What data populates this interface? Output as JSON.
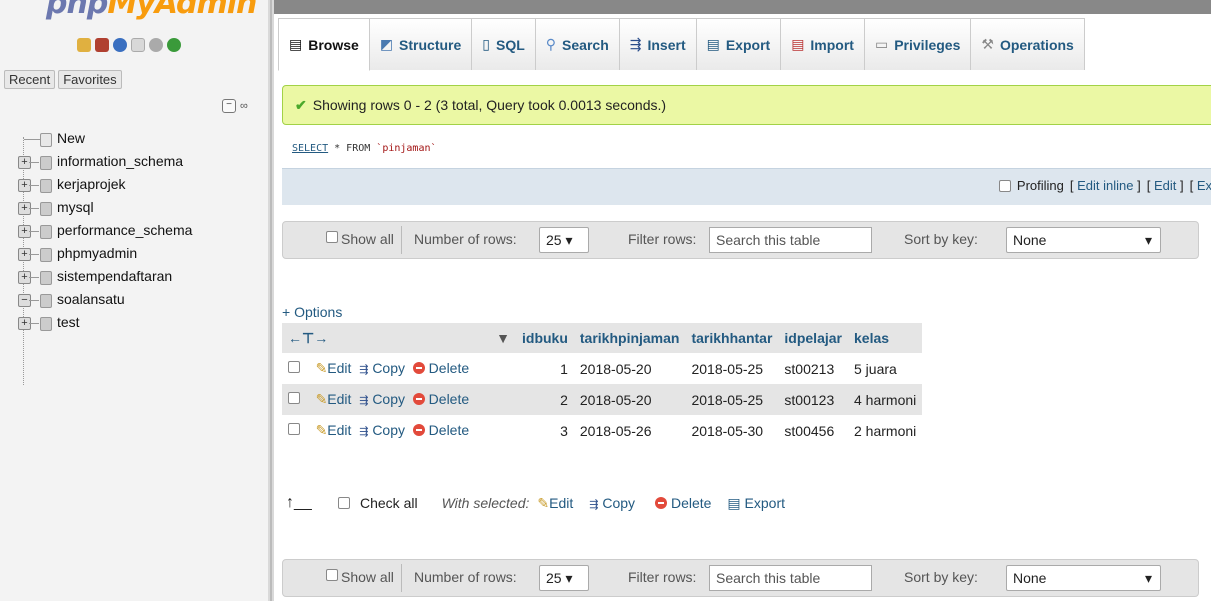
{
  "nav": {
    "logo_a": "php",
    "logo_b": "MyAdmin",
    "tabs": [
      "Recent",
      "Favorites"
    ],
    "tree": [
      {
        "label": "New",
        "type": "new"
      },
      {
        "label": "information_schema",
        "type": "db"
      },
      {
        "label": "kerjaprojek",
        "type": "db"
      },
      {
        "label": "mysql",
        "type": "db"
      },
      {
        "label": "performance_schema",
        "type": "db"
      },
      {
        "label": "phpmyadmin",
        "type": "db"
      },
      {
        "label": "sistempendaftaran",
        "type": "db"
      },
      {
        "label": "soalansatu",
        "type": "db-open"
      },
      {
        "label": "test",
        "type": "db"
      }
    ]
  },
  "tabs": [
    {
      "label": "Browse",
      "icon": "browse-icon"
    },
    {
      "label": "Structure",
      "icon": "structure-icon"
    },
    {
      "label": "SQL",
      "icon": "sql-icon"
    },
    {
      "label": "Search",
      "icon": "search-icon"
    },
    {
      "label": "Insert",
      "icon": "insert-icon"
    },
    {
      "label": "Export",
      "icon": "export-icon"
    },
    {
      "label": "Import",
      "icon": "import-icon"
    },
    {
      "label": "Privileges",
      "icon": "privileges-icon"
    },
    {
      "label": "Operations",
      "icon": "operations-icon"
    }
  ],
  "message": "Showing rows 0 - 2 (3 total, Query took 0.0013 seconds.)",
  "sql": {
    "keyword": "SELECT",
    "rest": " * FROM ",
    "table": "`pinjaman`"
  },
  "profiling": {
    "label": "Profiling",
    "edit_inline": "Edit inline",
    "edit": "Edit",
    "explain": "Ex"
  },
  "navbar": {
    "show_all": "Show all",
    "rows_label": "Number of rows:",
    "rows_value": "25",
    "filter_label": "Filter rows:",
    "filter_placeholder": "Search this table",
    "sort_label": "Sort by key:",
    "sort_value": "None"
  },
  "options": "+ Options",
  "table": {
    "columns": [
      "idbuku",
      "tarikhpinjaman",
      "tarikhhantar",
      "idpelajar",
      "kelas"
    ],
    "rows": [
      [
        "1",
        "2018-05-20",
        "2018-05-25",
        "st00213",
        "5 juara"
      ],
      [
        "2",
        "2018-05-20",
        "2018-05-25",
        "st00123",
        "4 harmoni"
      ],
      [
        "3",
        "2018-05-26",
        "2018-05-30",
        "st00456",
        "2 harmoni"
      ]
    ],
    "actions": {
      "edit": "Edit",
      "copy": "Copy",
      "delete": "Delete"
    }
  },
  "bulk": {
    "check_all": "Check all",
    "with_selected": "With selected:",
    "edit": "Edit",
    "copy": "Copy",
    "delete": "Delete",
    "export": "Export"
  }
}
